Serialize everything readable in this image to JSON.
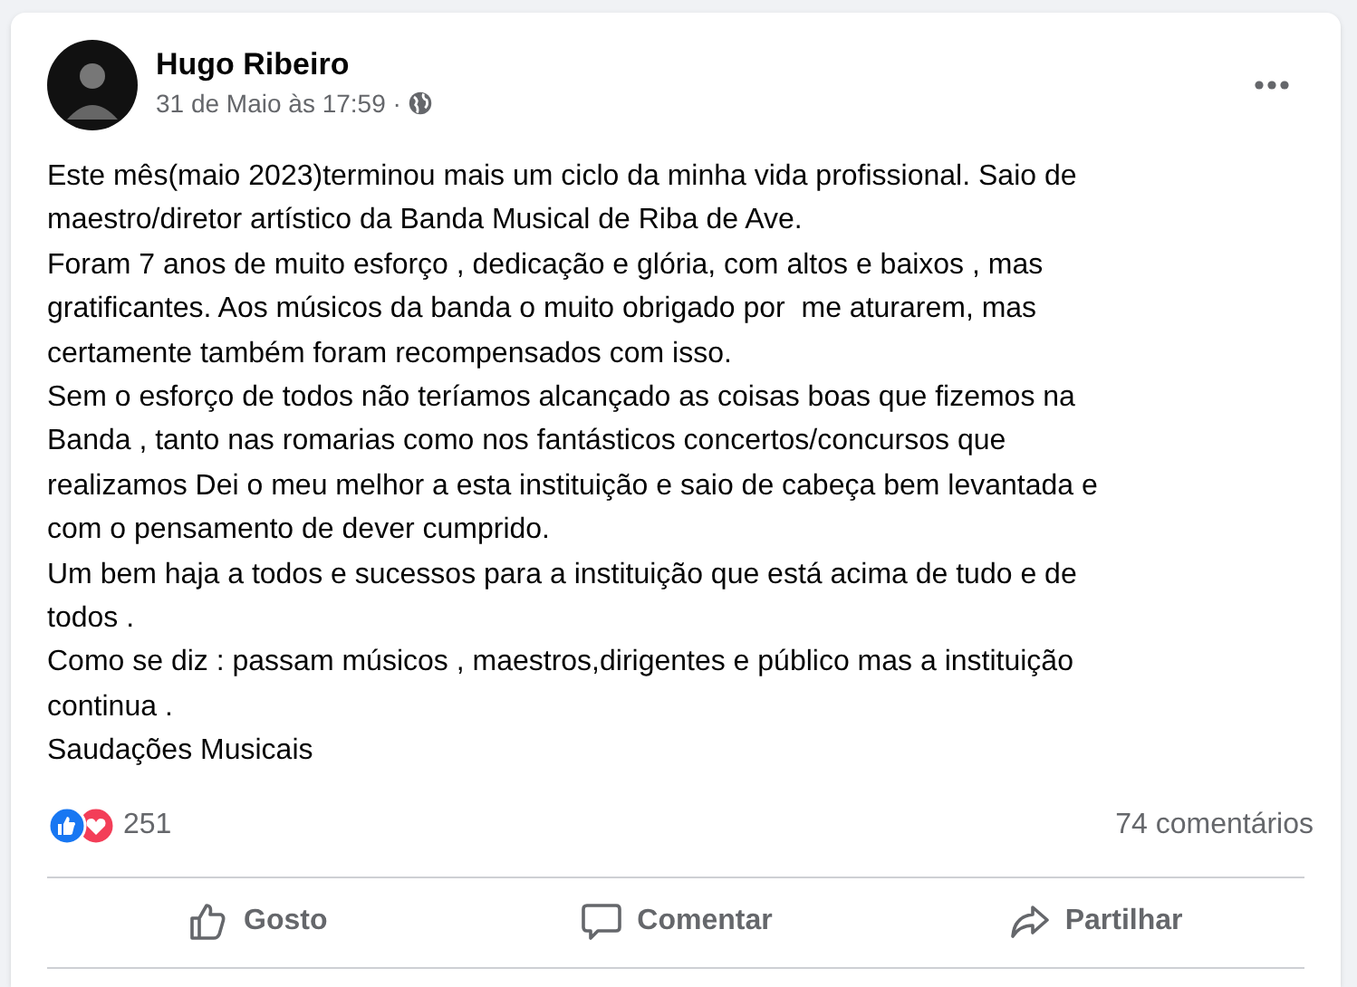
{
  "post": {
    "author": "Hugo Ribeiro",
    "timestamp": "31 de Maio às 17:59 ·",
    "paragraphs": [
      [
        "Este mês(maio 2023)terminou mais um ciclo da minha vida profissional. Saio de",
        "maestro/diretor artístico da Banda Musical de Riba de Ave."
      ],
      [
        "Foram 7 anos de muito esforço , dedicação e glória, com altos e baixos , mas",
        "gratificantes. Aos músicos da banda o muito obrigado por  me aturarem, mas",
        "certamente também foram recompensados com isso."
      ],
      [
        "Sem o esforço de todos não teríamos alcançado as coisas boas que fizemos na",
        "Banda , tanto nas romarias como nos fantásticos concertos/concursos que",
        "realizamos Dei o meu melhor a esta instituição e saio de cabeça bem levantada e",
        "com o pensamento de dever cumprido."
      ],
      [
        "Um bem haja a todos e sucessos para a instituição que está acima de tudo e de",
        "todos ."
      ],
      [
        "Como se diz : passam músicos , maestros,dirigentes e público mas a instituição",
        "continua ."
      ],
      [
        "Saudações Musicais"
      ]
    ],
    "reaction_count": "251",
    "comments_count": "74 comentários",
    "actions": [
      {
        "kind": "like",
        "label": "Gosto"
      },
      {
        "kind": "comment",
        "label": "Comentar"
      },
      {
        "kind": "share",
        "label": "Partilhar"
      }
    ]
  }
}
